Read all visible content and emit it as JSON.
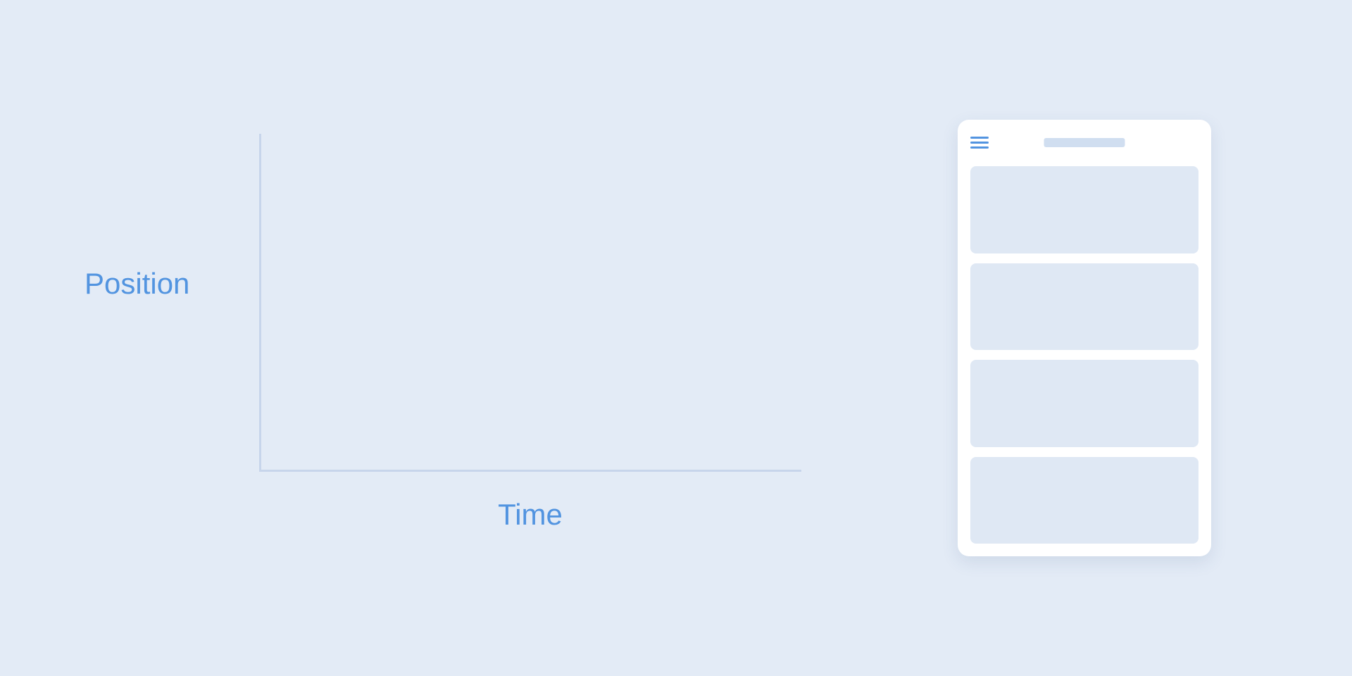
{
  "chart_data": {
    "type": "line",
    "title": "",
    "xlabel": "Time",
    "ylabel": "Position",
    "x": [],
    "values": [],
    "series": [],
    "xlim": null,
    "ylim": null,
    "grid": false,
    "legend": false,
    "note": "Empty axes only — no plotted data visible"
  },
  "phone": {
    "cards_count": 4
  }
}
